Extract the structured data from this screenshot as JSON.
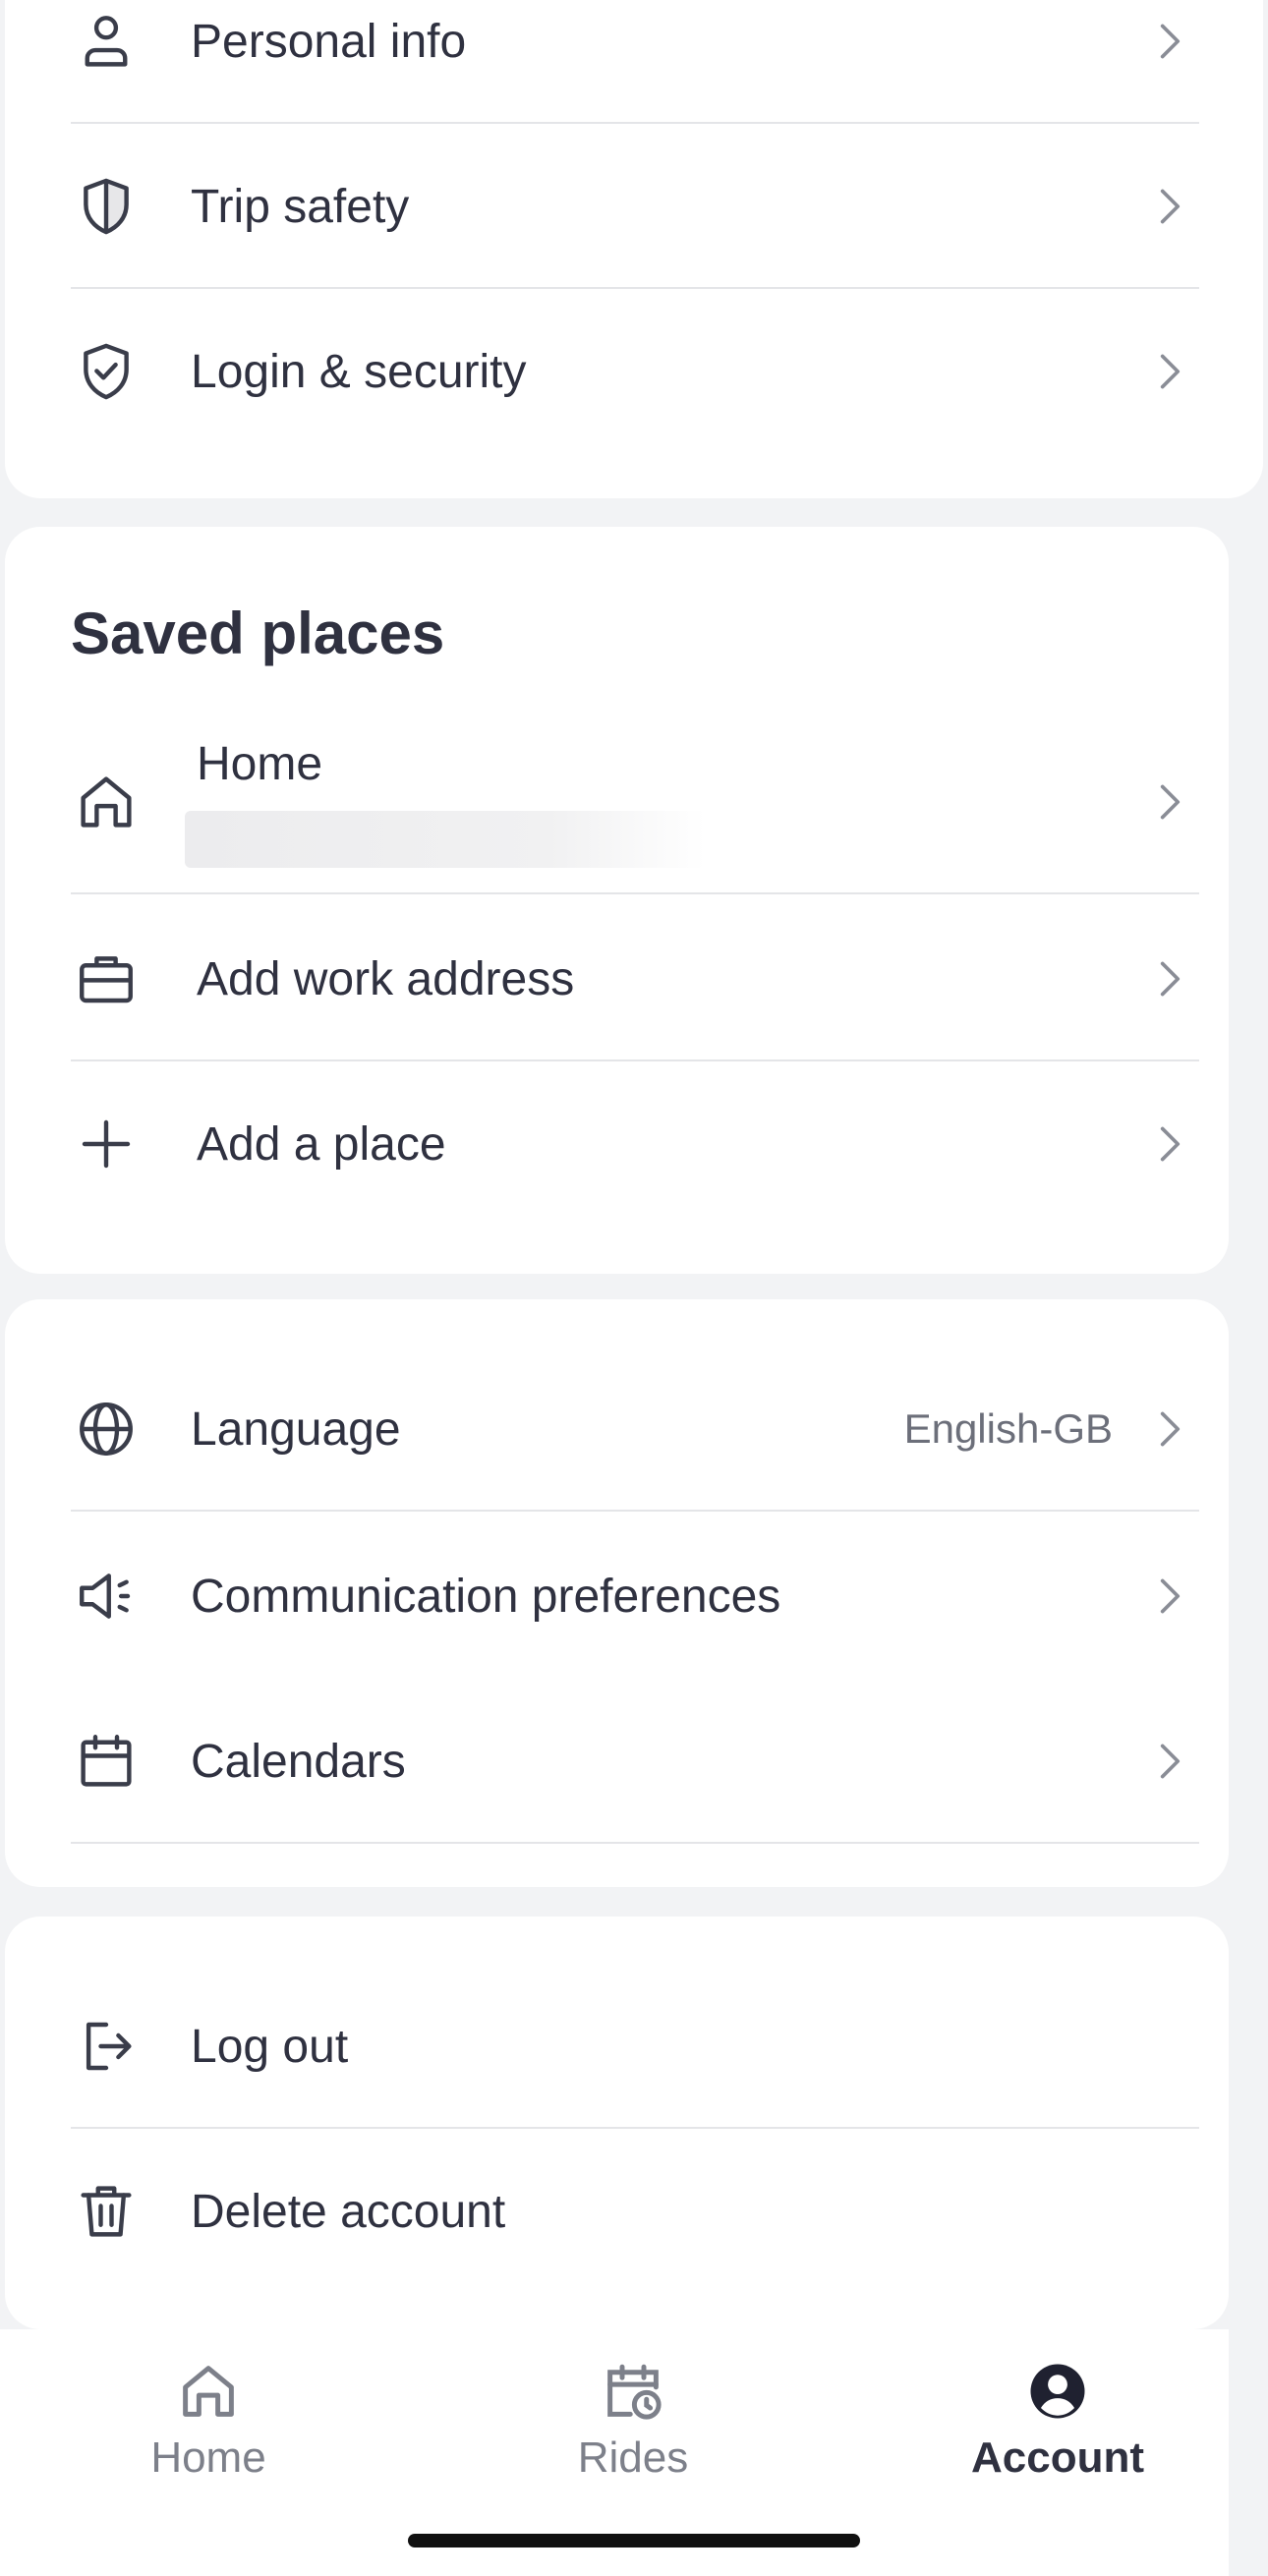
{
  "account_rows": [
    {
      "label": "Personal info",
      "icon": "person-icon"
    },
    {
      "label": "Trip safety",
      "icon": "shield-icon"
    },
    {
      "label": "Login & security",
      "icon": "shield-check-icon"
    }
  ],
  "saved_places": {
    "title": "Saved places",
    "home": {
      "label": "Home",
      "address_redacted": true
    },
    "work": {
      "label": "Add work address"
    },
    "add": {
      "label": "Add a place"
    }
  },
  "preferences": {
    "language": {
      "label": "Language",
      "value": "English-GB"
    },
    "communication": {
      "label": "Communication preferences"
    },
    "calendars": {
      "label": "Calendars"
    }
  },
  "session": {
    "logout": {
      "label": "Log out"
    },
    "delete": {
      "label": "Delete account"
    }
  },
  "tabbar": {
    "home": "Home",
    "rides": "Rides",
    "account": "Account",
    "active": "account"
  },
  "colors": {
    "text": "#2f3140",
    "muted": "#6c6f7a",
    "icon": "#3a3d4a",
    "chevron": "#8a8d96",
    "background": "#f2f3f5",
    "divider": "#e4e5e8"
  }
}
